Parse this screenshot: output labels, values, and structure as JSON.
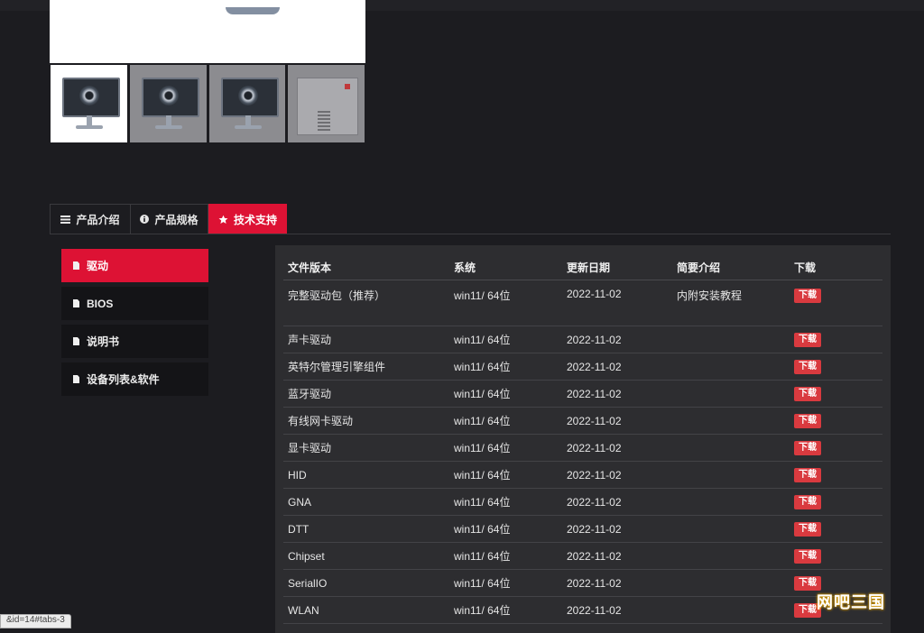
{
  "product_tabs": [
    {
      "label": "产品介绍",
      "icon": "list-icon"
    },
    {
      "label": "产品规格",
      "icon": "info-icon"
    },
    {
      "label": "技术支持",
      "icon": "star-icon",
      "active": true
    }
  ],
  "sidebar": {
    "items": [
      {
        "label": "驱动",
        "icon": "document-icon",
        "active": true
      },
      {
        "label": "BIOS",
        "icon": "document-icon"
      },
      {
        "label": "说明书",
        "icon": "document-icon"
      },
      {
        "label": "设备列表&软件",
        "icon": "document-icon"
      }
    ]
  },
  "table": {
    "headers": [
      "文件版本",
      "系统",
      "更新日期",
      "简要介绍",
      "下载"
    ],
    "rows": [
      {
        "name": "完整驱动包（推荐）",
        "system": "win11/ 64位",
        "date": "2022-11-02",
        "desc": "内附安装教程",
        "download": "下载"
      },
      {
        "name": "声卡驱动",
        "system": "win11/ 64位",
        "date": "2022-11-02",
        "desc": "",
        "download": "下载"
      },
      {
        "name": "英特尔管理引擎组件",
        "system": "win11/ 64位",
        "date": "2022-11-02",
        "desc": "",
        "download": "下载"
      },
      {
        "name": "蓝牙驱动",
        "system": "win11/ 64位",
        "date": "2022-11-02",
        "desc": "",
        "download": "下载"
      },
      {
        "name": "有线网卡驱动",
        "system": "win11/ 64位",
        "date": "2022-11-02",
        "desc": "",
        "download": "下载"
      },
      {
        "name": "显卡驱动",
        "system": "win11/ 64位",
        "date": "2022-11-02",
        "desc": "",
        "download": "下载"
      },
      {
        "name": "HID",
        "system": "win11/ 64位",
        "date": "2022-11-02",
        "desc": "",
        "download": "下载"
      },
      {
        "name": "GNA",
        "system": "win11/ 64位",
        "date": "2022-11-02",
        "desc": "",
        "download": "下载"
      },
      {
        "name": "DTT",
        "system": "win11/ 64位",
        "date": "2022-11-02",
        "desc": "",
        "download": "下载"
      },
      {
        "name": "Chipset",
        "system": "win11/ 64位",
        "date": "2022-11-02",
        "desc": "",
        "download": "下载"
      },
      {
        "name": "SerialIO",
        "system": "win11/ 64位",
        "date": "2022-11-02",
        "desc": "",
        "download": "下载"
      },
      {
        "name": "WLAN",
        "system": "win11/ 64位",
        "date": "2022-11-02",
        "desc": "",
        "download": "下载"
      }
    ]
  },
  "status_url": "&id=14#tabs-3",
  "watermark": "网吧三国",
  "colors": {
    "accent": "#dd1234",
    "download_button": "#d93a3f",
    "background": "#1c1c20",
    "panel": "#2d2d30"
  }
}
